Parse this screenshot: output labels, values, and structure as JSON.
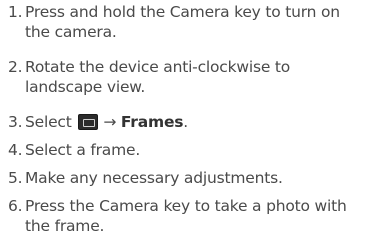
{
  "steps": [
    {
      "number": "1.",
      "text": "Press and hold the Camera key to turn on the camera."
    },
    {
      "number": "2.",
      "text": "Rotate the device anti-clockwise to landscape view."
    },
    {
      "number": "3.",
      "prefix": "Select",
      "arrow": "→",
      "target": "Frames",
      "suffix": ".",
      "icon": "menu-icon"
    },
    {
      "number": "4.",
      "text": "Select a frame."
    },
    {
      "number": "5.",
      "text": "Make any necessary adjustments."
    },
    {
      "number": "6.",
      "text": "Press the Camera key to take a photo with the frame."
    }
  ]
}
